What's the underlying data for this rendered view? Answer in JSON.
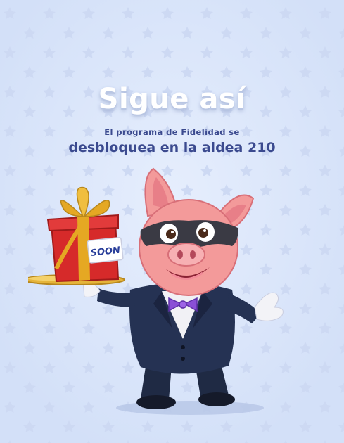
{
  "screen": {
    "title": "Sigue así",
    "subtitle_line1": "El programa de Fidelidad se",
    "subtitle_line2": "desbloquea en la aldea 210",
    "gift_tag": "SOON"
  },
  "colors": {
    "background": "#dbe6fb",
    "title": "#ffffff",
    "subtitle": "#3b4a8f",
    "gift_box": "#d62a2a",
    "ribbon": "#e5a823",
    "bow_tie": "#8a4fd6",
    "suit": "#1f2a44",
    "pig_skin": "#f39a9a",
    "mask": "#3a3a44"
  },
  "icons": [
    "pig-mascot-icon",
    "gift-box-icon",
    "bow-tie-icon",
    "pattern-star-icon"
  ]
}
